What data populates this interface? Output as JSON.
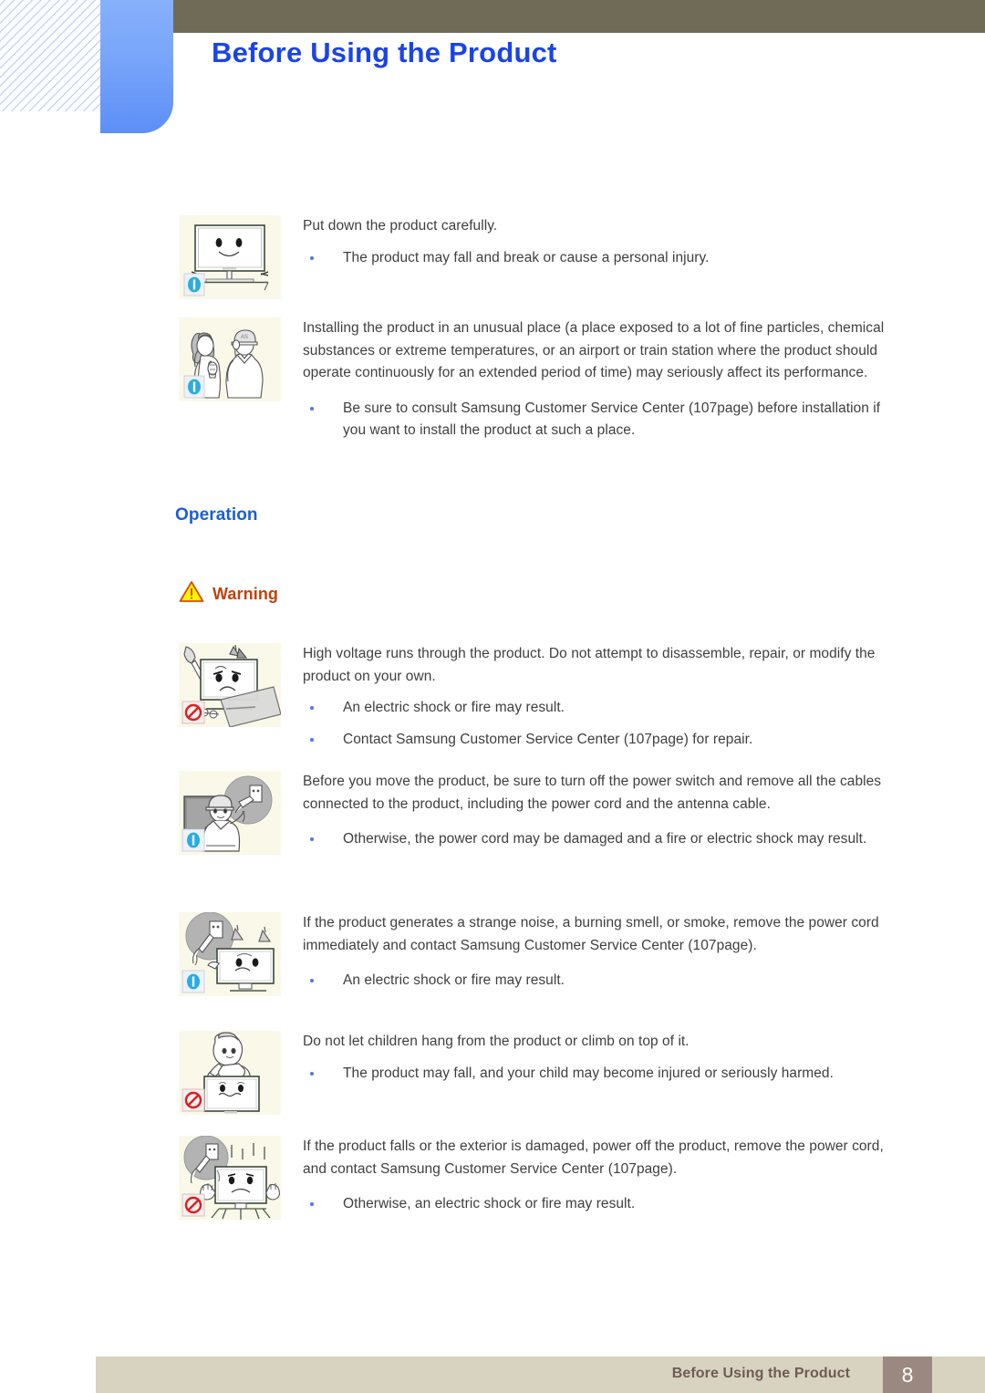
{
  "header": {
    "title": "Before Using the Product",
    "title_color": "#1b44e8",
    "bar_color": "#706b56",
    "tab_color": "#5c8ff7"
  },
  "sections": [
    {
      "heading": "Operation",
      "heading_color": "#1b5fd4",
      "warning_label": "Warning",
      "warning_color": "#c2410c"
    }
  ],
  "blocks": [
    {
      "icon": "monitor-smiley-caution-icon",
      "badge": "caution-badge",
      "paragraph": "Put down the product carefully.",
      "bullets": [
        "The product may fall and break or cause a personal injury."
      ]
    },
    {
      "icon": "people-phone-caution-icon",
      "badge": "caution-badge",
      "paragraph": "Installing the product in an unusual place (a place exposed to a lot of fine particles, chemical substances or extreme temperatures, or an airport or train station where the product should operate continuously for an extended period of time) may seriously affect its performance.",
      "bullets": [
        "Be sure to consult Samsung Customer Service Center (107page) before installation if you want to install the product at such a place."
      ]
    },
    {
      "icon": "monitor-disassemble-prohibited-icon",
      "badge": "prohibition-badge",
      "paragraph": "High voltage runs through the product. Do not attempt to disassemble, repair, or modify the product on your own.",
      "bullets": [
        "An electric shock or fire may result.",
        "Contact Samsung Customer Service Center (107page) for repair."
      ]
    },
    {
      "icon": "unplug-cord-caution-icon",
      "badge": "caution-badge",
      "paragraph": "Before you move the product, be sure to turn off the power switch and remove all the cables connected to the product, including the power cord and the antenna cable.",
      "bullets": [
        "Otherwise, the power cord may be damaged and a fire or electric shock may result."
      ]
    },
    {
      "icon": "monitor-smoke-unplug-caution-icon",
      "badge": "caution-badge",
      "paragraph": "If the product generates a strange noise, a burning smell, or smoke, remove the power cord immediately and contact Samsung Customer Service Center (107page).",
      "bullets": [
        "An electric shock or fire may result."
      ]
    },
    {
      "icon": "child-climbing-monitor-prohibited-icon",
      "badge": "prohibition-badge",
      "paragraph": "Do not let children hang from the product or climb on top of it.",
      "bullets": [
        "The product may fall, and your child may become injured or seriously harmed."
      ]
    },
    {
      "icon": "monitor-falling-prohibited-icon",
      "badge": "prohibition-badge",
      "paragraph": "If the product falls or the exterior is damaged, power off the product, remove the power cord, and contact Samsung Customer Service Center (107page).",
      "bullets": [
        "Otherwise, an electric shock or fire may result."
      ]
    }
  ],
  "footer": {
    "label": "Before Using the Product",
    "page_number": "8",
    "bar_color": "#d8d2c0",
    "page_box_color": "#9b8880",
    "text_color": "#6f5b56"
  }
}
